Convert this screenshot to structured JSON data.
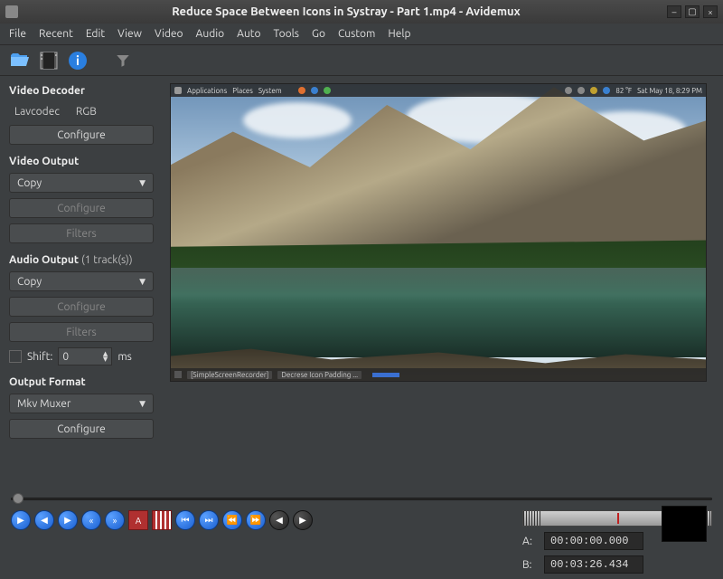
{
  "window": {
    "title": "Reduce Space Between Icons in Systray - Part 1.mp4 - Avidemux"
  },
  "menu": {
    "file": "File",
    "recent": "Recent",
    "edit": "Edit",
    "view": "View",
    "video": "Video",
    "audio": "Audio",
    "auto": "Auto",
    "tools": "Tools",
    "go": "Go",
    "custom": "Custom",
    "help": "Help"
  },
  "side": {
    "decoder_title": "Video Decoder",
    "decoder_val1": "Lavcodec",
    "decoder_val2": "RGB",
    "configure": "Configure",
    "voutput_title": "Video Output",
    "voutput_sel": "Copy",
    "filters": "Filters",
    "aoutput_title": "Audio Output",
    "aoutput_tracks": "(1 track(s))",
    "aoutput_sel": "Copy",
    "shift_label": "Shift:",
    "shift_val": "0",
    "shift_unit": "ms",
    "format_title": "Output Format",
    "format_sel": "Mkv Muxer"
  },
  "desktop": {
    "apps": "Applications",
    "places": "Places",
    "system": "System",
    "temp": "82 °F",
    "date": "Sat May 18, 8:29 PM",
    "task1": "[SimpleScreenRecorder]",
    "task2": "Decrese Icon Padding ..."
  },
  "markers": {
    "a_label": "A:",
    "a_value": "00:00:00.000",
    "b_label": "B:",
    "b_value": "00:03:26.434"
  }
}
